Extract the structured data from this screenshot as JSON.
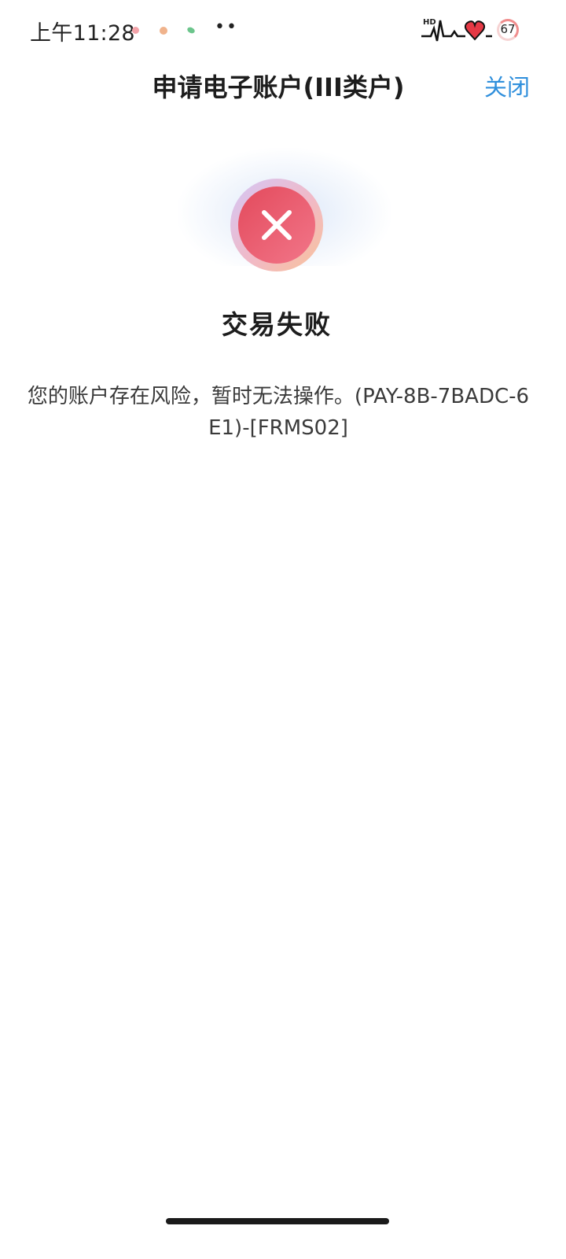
{
  "status_bar": {
    "time": "上午11:28",
    "more_indicator": "••",
    "hd_label": "HD",
    "battery_level": "67"
  },
  "nav": {
    "title": "申请电子账户(III类户)",
    "close_label": "关闭"
  },
  "result": {
    "status": "error",
    "icon": "close-icon",
    "title": "交易失败",
    "message": "您的账户存在风险，暂时无法操作。(PAY-8B-7BADC-6E1)-[FRMS02]"
  },
  "colors": {
    "accent": "#2f8fdc",
    "error": "#e34a5c"
  }
}
